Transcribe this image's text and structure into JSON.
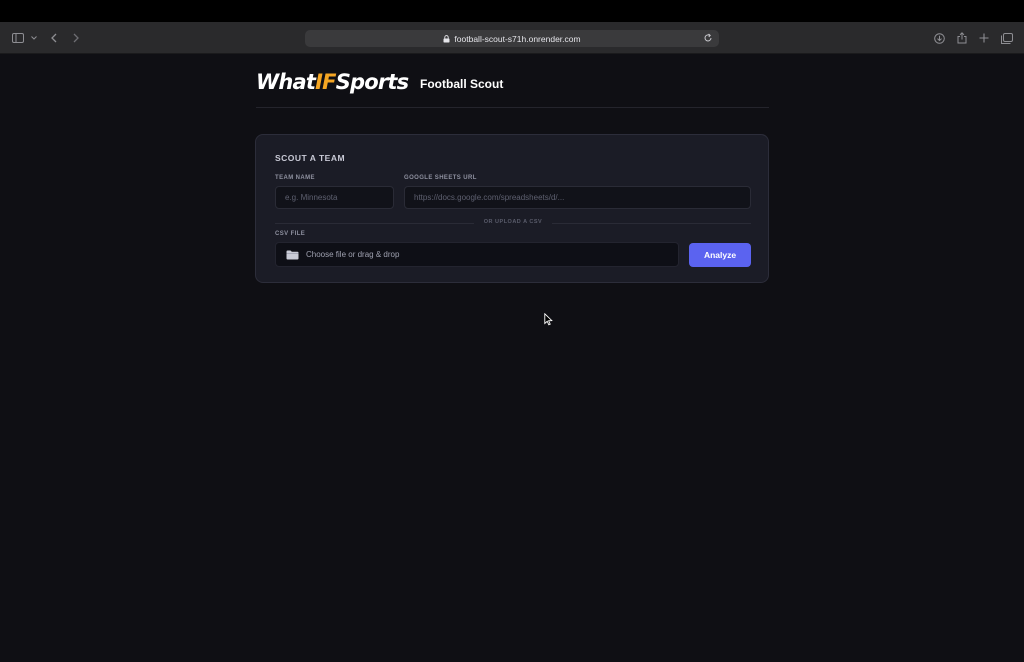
{
  "browser": {
    "url": "football-scout-s71h.onrender.com"
  },
  "header": {
    "logo_part1": "What",
    "logo_part2": "IF",
    "logo_part3": "Sports",
    "title": "Football Scout"
  },
  "card": {
    "title": "SCOUT A TEAM",
    "team_name": {
      "label": "TEAM NAME",
      "placeholder": "e.g. Minnesota"
    },
    "sheets_url": {
      "label": "GOOGLE SHEETS URL",
      "placeholder": "https://docs.google.com/spreadsheets/d/..."
    },
    "divider": "OR UPLOAD A CSV",
    "csv": {
      "label": "CSV FILE",
      "prompt": "Choose file or drag & drop"
    },
    "analyze_label": "Analyze"
  },
  "colors": {
    "background": "#0f0f14",
    "card": "#1b1c26",
    "accent": "#5b63f0",
    "logo_accent": "#f5a623"
  }
}
